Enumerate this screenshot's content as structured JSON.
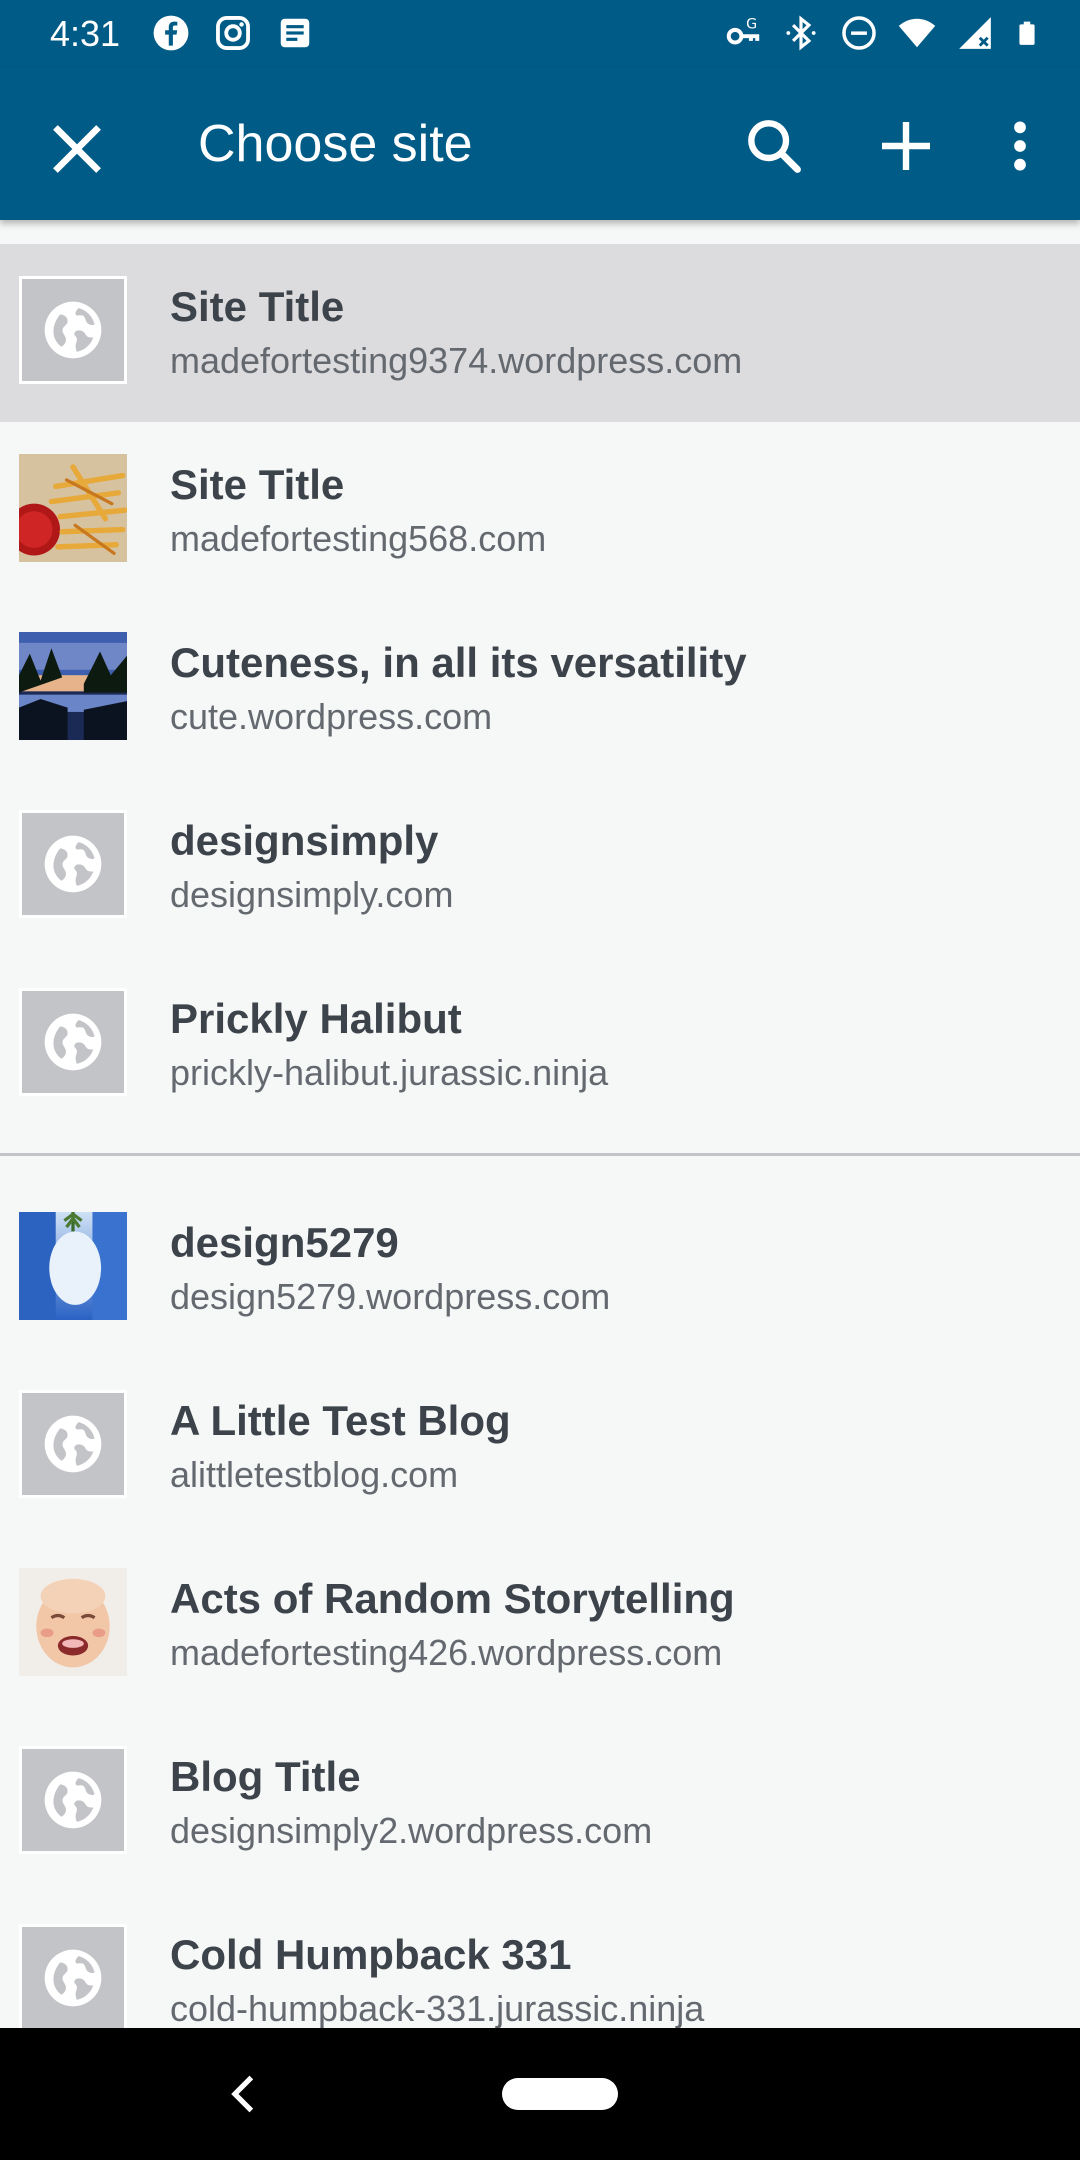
{
  "status_bar": {
    "time": "4:31",
    "left_icons": [
      "facebook-icon",
      "instagram-icon",
      "news-icon"
    ],
    "right_icons": [
      "vpn-key-icon",
      "bluetooth-icon",
      "do-not-disturb-icon",
      "wifi-icon",
      "cell-signal-icon",
      "battery-icon"
    ]
  },
  "app_bar": {
    "title": "Choose site",
    "close_icon": "close-icon",
    "actions": [
      "search-icon",
      "add-icon",
      "more-vert-icon"
    ],
    "color": "#005b87"
  },
  "sites": [
    {
      "name": "Site Title",
      "url": "madefortesting9374.wordpress.com",
      "thumbnail": "globe-icon",
      "selected": true
    },
    {
      "name": "Site Title",
      "url": "madefortesting568.com",
      "thumbnail": "fries-photo",
      "selected": false
    },
    {
      "name": "Cuteness, in all its versatility",
      "url": "cute.wordpress.com",
      "thumbnail": "lake-photo",
      "selected": false
    },
    {
      "name": "designsimply",
      "url": "designsimply.com",
      "thumbnail": "globe-icon",
      "selected": false
    },
    {
      "name": "Prickly Halibut",
      "url": "prickly-halibut.jurassic.ninja",
      "thumbnail": "globe-icon",
      "selected": false
    },
    {
      "name": "design5279",
      "url": "design5279.wordpress.com",
      "thumbnail": "sky-photo",
      "selected": false
    },
    {
      "name": "A Little Test Blog",
      "url": "alittletestblog.com",
      "thumbnail": "globe-icon",
      "selected": false
    },
    {
      "name": "Acts of Random Storytelling",
      "url": "madefortesting426.wordpress.com",
      "thumbnail": "baby-photo",
      "selected": false
    },
    {
      "name": "Blog Title",
      "url": "designsimply2.wordpress.com",
      "thumbnail": "globe-icon",
      "selected": false
    },
    {
      "name": "Cold Humpback 331",
      "url": "cold-humpback-331.jurassic.ninja",
      "thumbnail": "globe-icon",
      "selected": false
    }
  ],
  "nav_bar": {
    "icons": [
      "back-icon",
      "home-pill-icon"
    ]
  }
}
